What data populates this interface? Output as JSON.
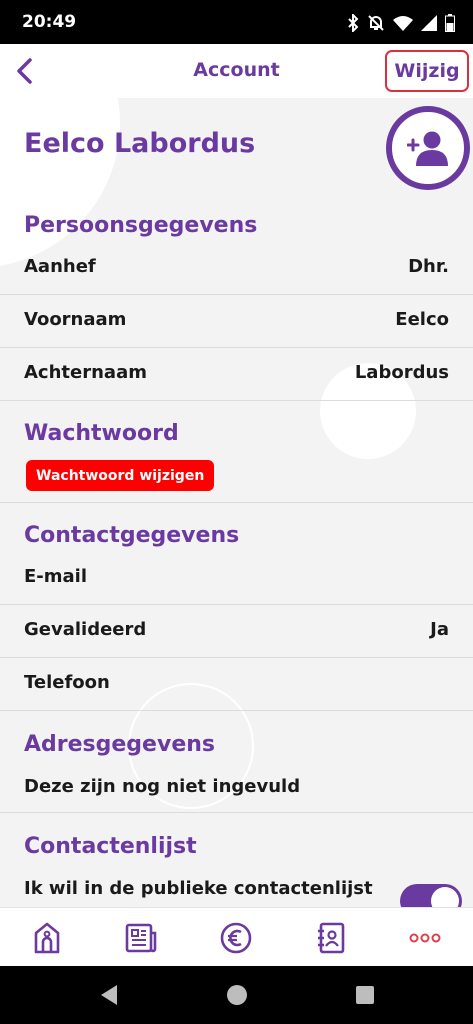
{
  "status_bar": {
    "time": "20:49",
    "icons": [
      "bluetooth-icon",
      "bell-muted-icon",
      "wifi-icon",
      "signal-icon",
      "battery-icon"
    ]
  },
  "app_bar": {
    "title": "Account",
    "edit_label": "Wijzig"
  },
  "profile": {
    "name": "Eelco Labordus"
  },
  "personal": {
    "title": "Persoonsgegevens",
    "rows": [
      {
        "label": "Aanhef",
        "value": "Dhr."
      },
      {
        "label": "Voornaam",
        "value": "Eelco"
      },
      {
        "label": "Achternaam",
        "value": "Labordus"
      }
    ]
  },
  "password": {
    "title": "Wachtwoord",
    "button_label": "Wachtwoord wijzigen"
  },
  "contact": {
    "title": "Contactgegevens",
    "rows": [
      {
        "label": "E-mail",
        "value": ""
      },
      {
        "label": "Gevalideerd",
        "value": "Ja"
      },
      {
        "label": "Telefoon",
        "value": ""
      }
    ]
  },
  "address": {
    "title": "Adresgegevens",
    "note": "Deze zijn nog niet ingevuld"
  },
  "contactlist": {
    "title": "Contactenlijst",
    "option_label": "Ik wil in de publieke contactenlijst",
    "toggle_on": true
  },
  "bottom_nav": {
    "items": [
      "home-icon",
      "news-icon",
      "euro-icon",
      "contacts-icon",
      "more-icon"
    ]
  },
  "colors": {
    "accent": "#6b3aa0",
    "danger": "#ff0000",
    "more_dots": "#e0404c"
  }
}
